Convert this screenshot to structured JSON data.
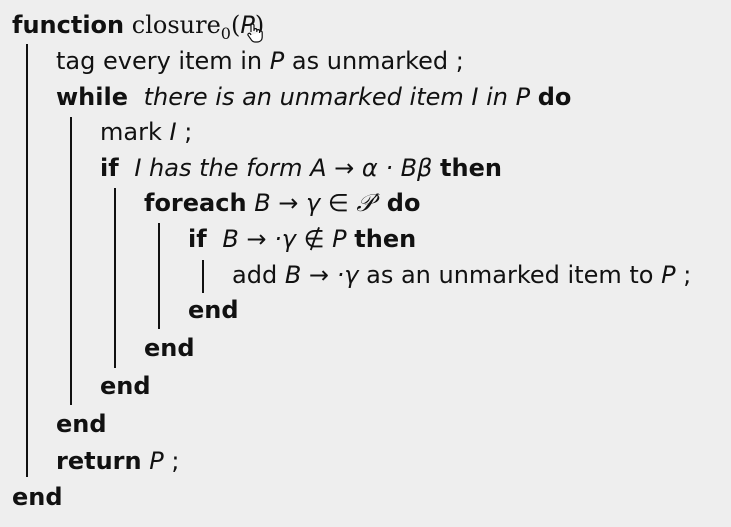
{
  "algorithm": {
    "line1": {
      "keyword": "function",
      "name": "closure",
      "subscript": "0",
      "open_paren": "(",
      "arg": "P",
      "close_paren": ")"
    },
    "line2": {
      "text_a": "tag every item in ",
      "var": "P",
      "text_b": " as unmarked ;"
    },
    "line3": {
      "keyword": "while",
      "cond": "there is an unmarked item I in P",
      "do": "do"
    },
    "line4": {
      "text": "mark ",
      "var": "I",
      "semi": " ;"
    },
    "line5": {
      "keyword": "if",
      "cond_a": "I has the form A → α · Bβ",
      "then": "then"
    },
    "line6": {
      "keyword": "foreach",
      "expr": "B → γ ∈ 𝒫′",
      "do": "do"
    },
    "line7": {
      "keyword": "if",
      "expr": "B → ·γ ∉ P",
      "then": "then"
    },
    "line8": {
      "text_a": "add ",
      "expr": "B → ·γ",
      "text_b": " as an unmarked item to ",
      "var": "P",
      "semi": " ;"
    },
    "end_if_inner": "end",
    "end_foreach": "end",
    "end_if": "end",
    "end_while": "end",
    "line_return": {
      "keyword": "return",
      "var": "P",
      "semi": " ;"
    },
    "end_function": "end"
  }
}
